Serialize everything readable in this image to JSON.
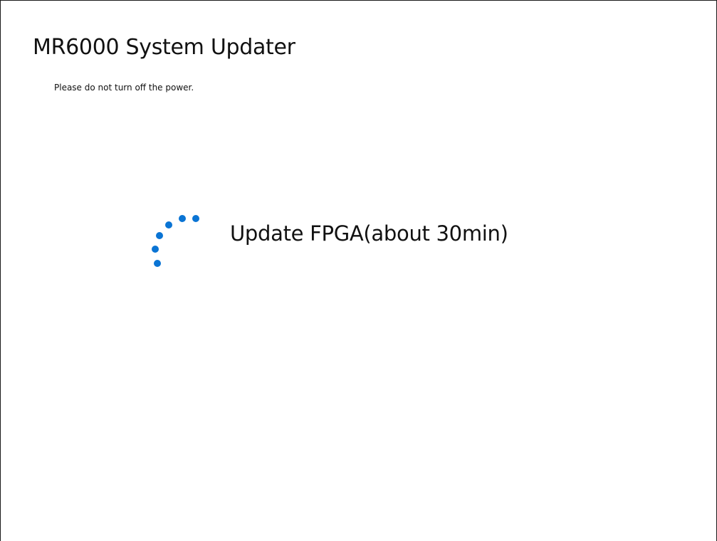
{
  "window": {
    "title": "MR6000 System Updater",
    "warning": "Please do not turn off the power."
  },
  "progress": {
    "status": "Update FPGA(about 30min)",
    "spinner_icon": "loading-spinner-icon",
    "accent_color": "#0a74d4"
  }
}
